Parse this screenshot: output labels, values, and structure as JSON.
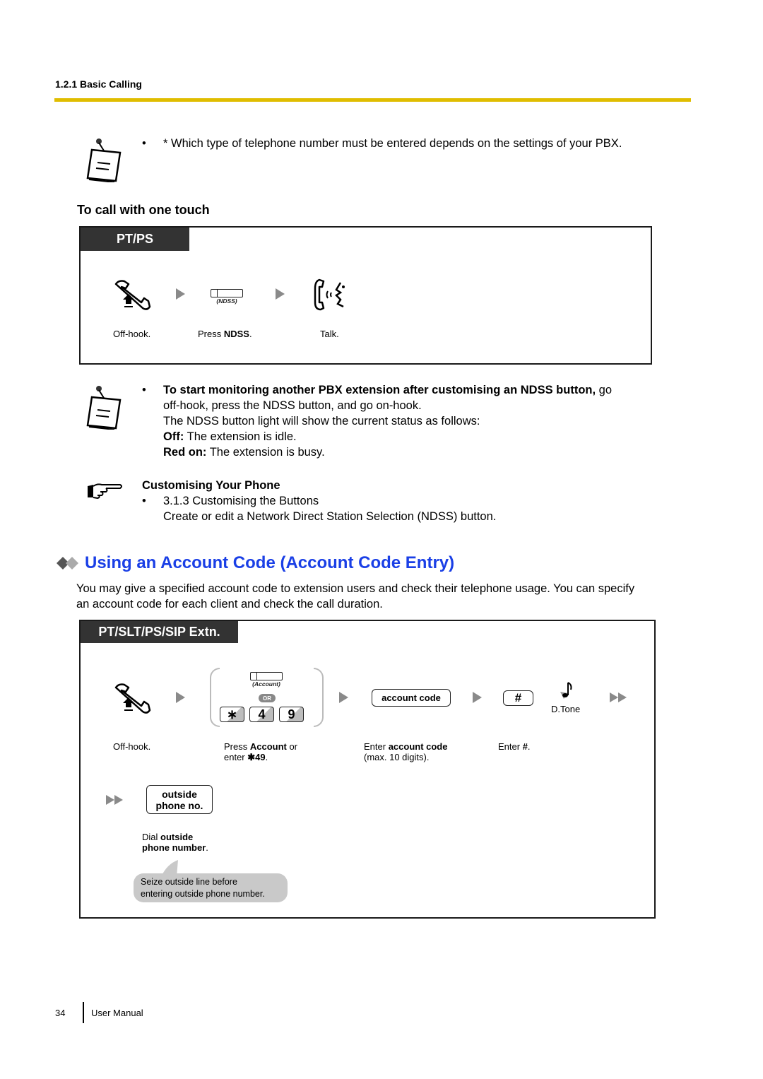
{
  "header": {
    "section": "1.2.1 Basic Calling"
  },
  "note1": {
    "text": "* Which type of telephone number must be entered depends on the settings of your PBX."
  },
  "one_touch": {
    "title": "To call with one touch",
    "tab": "PT/PS",
    "key_label": "(NDSS)",
    "steps": [
      {
        "pre": "Off-hook.",
        "bold": "",
        "post": ""
      },
      {
        "pre": "Press ",
        "bold": "NDSS",
        "post": "."
      },
      {
        "pre": "Talk.",
        "bold": "",
        "post": ""
      }
    ]
  },
  "note2": {
    "bold_lead": "To start monitoring another PBX extension after customising an NDSS button,",
    "lead_rest": " go",
    "line2": "off-hook, press the NDSS button, and go on-hook.",
    "line3": "The NDSS button light will show the current status as follows:",
    "status": [
      {
        "label": "Off:",
        "text": " The extension is idle."
      },
      {
        "label": "Red on:",
        "text": " The extension is busy."
      }
    ]
  },
  "reference": {
    "title": "Customising Your Phone",
    "item": "3.1.3  Customising the Buttons",
    "desc": "Create or edit a Network Direct Station Selection (NDSS) button."
  },
  "account_code": {
    "heading": "Using an Account Code (Account Code Entry)",
    "intro_line1": "You may give a specified account code to extension users and check their telephone usage. You can specify",
    "intro_line2": "an account code for each client and check the call duration.",
    "tab": "PT/SLT/PS/SIP Extn.",
    "account_key_label": "(Account)",
    "or_label": "OR",
    "dial_keys": [
      "∗",
      "4",
      "9"
    ],
    "account_code_btn": "account code",
    "hash_btn": "#",
    "dtone_label": "D.Tone",
    "outside_btn_line1": "outside",
    "outside_btn_line2": "phone no.",
    "captions": {
      "offhook": "Off-hook.",
      "press_pre": "Press ",
      "press_bold": "Account",
      "press_post": " or",
      "enter_pre": "enter ",
      "enter_bold": "✱49",
      "enter_post": ".",
      "code_pre": "Enter ",
      "code_bold": "account code",
      "code_line2": "(max. 10 digits).",
      "hash_pre": "Enter ",
      "hash_bold": "#",
      "hash_post": ".",
      "dial_pre": "Dial ",
      "dial_bold1": "outside",
      "dial_bold2": "phone number",
      "dial_post": "."
    },
    "bubble_line1": "Seize outside line before",
    "bubble_line2": "entering outside phone number."
  },
  "footer": {
    "page": "34",
    "label": "User Manual"
  }
}
